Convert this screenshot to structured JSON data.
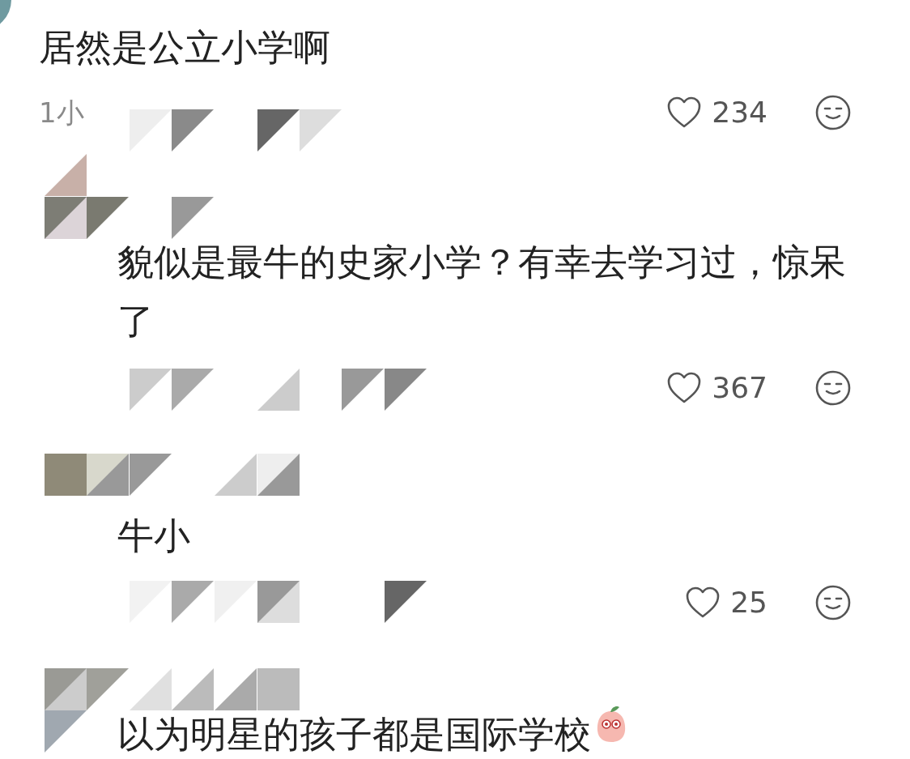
{
  "comments": [
    {
      "kind": "comment",
      "text": "居然是公立小学啊",
      "meta": "1小",
      "likes": "234"
    },
    {
      "kind": "reply",
      "text": "貌似是最牛的史家小学？有幸去学习过，惊呆了",
      "likes": "367"
    },
    {
      "kind": "reply",
      "text": "牛小",
      "likes": "25"
    },
    {
      "kind": "reply",
      "text": "以为明星的孩子都是国际学校",
      "sticker": true
    }
  ]
}
